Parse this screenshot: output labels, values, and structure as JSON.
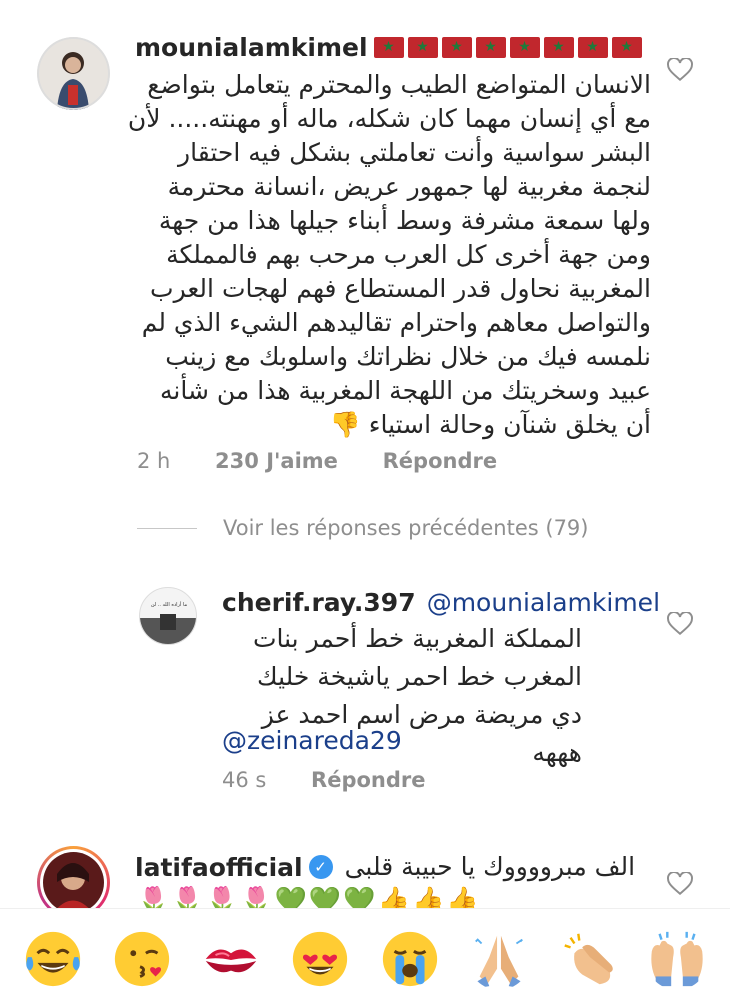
{
  "comment1": {
    "username": "mounialamkimel",
    "lines": [
      "الانسان المتواضع الطيب والمحترم يتعامل بتواضع",
      "مع أي إنسان مهما كان شكله، ماله أو مهنته..... لأن",
      "البشر سواسية وأنت تعاملتي بشكل فيه احتقار",
      "لنجمة مغربية لها جمهور عريض ،انسانة محترمة",
      "ولها سمعة مشرفة وسط أبناء جيلها هذا من جهة",
      "ومن جهة أخرى كل العرب مرحب بهم فالمملكة",
      "المغربية نحاول قدر المستطاع فهم لهجات العرب",
      "والتواصل معاهم واحترام تقاليدهم الشيء الذي لم",
      "نلمسه فيك من خلال نظراتك واسلوبك مع زينب",
      "عبيد وسخريتك من اللهجة المغربية هذا من شأنه",
      "أن يخلق شنآن وحالة استياء 👎"
    ],
    "time": "2 h",
    "likes": "230 J'aime",
    "reply": "Répondre"
  },
  "view_replies": "Voir les réponses précédentes (79)",
  "comment2": {
    "username": "cherif.ray.397",
    "mention": "@mounialamkimel",
    "avatar_text": "ما أراده الله .. لن",
    "lines": [
      "المملكة المغربية خط أحمر بنات",
      "المغرب خط احمر  ياشيخة خليك",
      "دي مريضة مرض اسم احمد عز هههه"
    ],
    "mention2": "@zeinareda29",
    "time": "46 s",
    "reply": "Répondre"
  },
  "comment3": {
    "username": "latifaofficial",
    "text": "الف مبرووووك يا حبيبة قلبى",
    "emoji_line": "🌷🌷🌷🌷💚💚💚👍👍👍"
  },
  "emoji_bar": [
    "face-tears-of-joy",
    "face-blowing-kiss",
    "kiss-mark",
    "heart-eyes",
    "loudly-crying",
    "folded-hands",
    "clapping-hands",
    "raising-hands"
  ]
}
